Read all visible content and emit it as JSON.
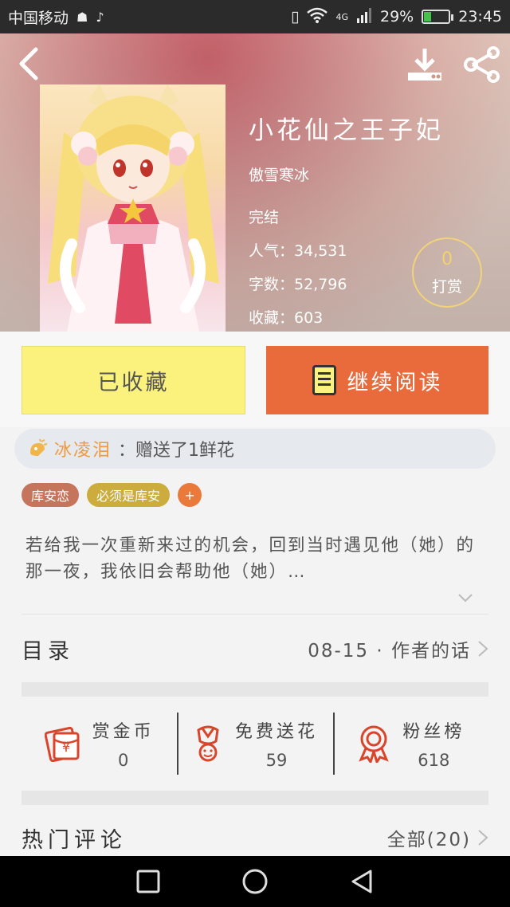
{
  "status_bar": {
    "carrier": "中国移动",
    "network": "4G",
    "battery": "29%",
    "battery_level": 0.29,
    "time": "23:45"
  },
  "book": {
    "title": "小花仙之王子妃",
    "author": "傲雪寒冰",
    "status": "完结",
    "popularity": "人气：34,531",
    "word_count": "字数：52,796",
    "favorites": "收藏：603"
  },
  "tip": {
    "count": "0",
    "label": "打赏"
  },
  "actions": {
    "favorite_label": "已收藏",
    "read_label": "继续阅读"
  },
  "gift_notice": {
    "user": "冰凌泪",
    "text": "：赠送了1鲜花"
  },
  "tags": [
    "库安恋",
    "必须是库安",
    "+"
  ],
  "description": "若给我一次重新来过的机会，回到当时遇见他（她）的那一夜，我依旧会帮助他（她）…",
  "toc": {
    "label": "目录",
    "latest": "08-15 · 作者的话"
  },
  "stats": [
    {
      "label": "赏金币",
      "value": "0",
      "icon": "red-envelope-icon"
    },
    {
      "label": "免费送花",
      "value": "59",
      "icon": "flower-icon"
    },
    {
      "label": "粉丝榜",
      "value": "618",
      "icon": "medal-icon"
    }
  ],
  "comments": {
    "label": "热门评论",
    "all": "全部(20)"
  },
  "colors": {
    "favorite_button": "#fbf27d",
    "read_button": "#e96b3c",
    "accent_orange": "#ee9a3f",
    "icon_red": "#d9452b"
  }
}
